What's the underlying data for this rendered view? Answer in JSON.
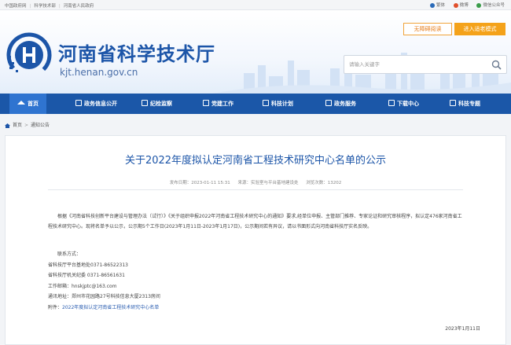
{
  "topbar": {
    "links": [
      "中国政府网",
      "科学技术部",
      "河南省人民政府"
    ],
    "right": [
      "繁体",
      "微博",
      "微信公众号"
    ]
  },
  "header": {
    "site_title": "河南省科学技术厅",
    "site_domain": "kjt.henan.gov.cn",
    "access_label": "无障碍阅读",
    "elder_label": "进入适老模式",
    "search_placeholder": "请输入关键字"
  },
  "nav": {
    "items": [
      "首页",
      "政务信息公开",
      "纪检监察",
      "党建工作",
      "科技计划",
      "政务服务",
      "下载中心",
      "科技专题"
    ]
  },
  "breadcrumb": [
    "首页",
    "通知公告"
  ],
  "article": {
    "title": "关于2022年度拟认定河南省工程技术研究中心名单的公示",
    "meta": {
      "date": "发布日期：2023-01-11 15:31",
      "source": "来源：实验室与平台基地建设处",
      "views": "浏览次数：13202"
    },
    "paragraph": "根据《河南省科技创新平台建设与管理办法（试行）》《关于组织申报2022年河南省工程技术研究中心的通知》要求,经单位申报、主管部门推荐、专家论证和研究审核程序，拟认定476家河南省工程技术研究中心。现将名单予以公示，公示期5个工作日(2023年1月11日-2023年1月17日)，公示期间若有异议，请以书面形式向河南省科技厅实名反映。",
    "contact_heading": "联系方式：",
    "contacts": [
      "省科技厅平台基地处0371-86522313",
      "省科技厅机关纪委 0371-86561631",
      "工作邮箱：hnskjptc@163.com",
      "通讯地址：郑州市花园路27号科技信息大厦2313房间"
    ],
    "attachment_label": "附件：",
    "attachment": "2022年度拟认定河南省工程技术研究中心名单",
    "sign_date": "2023年1月11日"
  },
  "colors": {
    "brand_blue": "#1b57a8",
    "nav_active": "#2f74d0",
    "accent_orange": "#f4a21a"
  }
}
